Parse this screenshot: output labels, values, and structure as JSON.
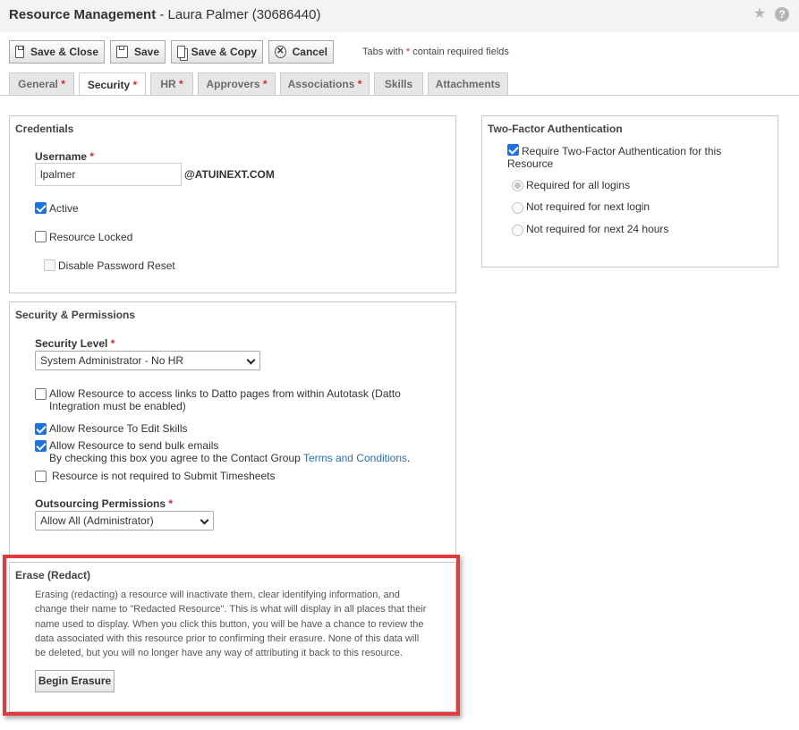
{
  "header": {
    "title_bold": "Resource Management",
    "title_rest": " - Laura Palmer (30686440)",
    "star_icon": "star-icon",
    "help_icon": "help-icon",
    "help_glyph": "?"
  },
  "toolbar": {
    "save_close_label": "Save & Close",
    "save_label": "Save",
    "save_copy_label": "Save & Copy",
    "cancel_label": "Cancel",
    "cancel_glyph": "✕",
    "required_note_prefix": "Tabs with ",
    "required_star": "*",
    "required_note_suffix": " contain required fields"
  },
  "tabs": [
    {
      "label": "General",
      "required": "*"
    },
    {
      "label": "Security",
      "required": "*"
    },
    {
      "label": "HR",
      "required": "*"
    },
    {
      "label": "Approvers",
      "required": "*"
    },
    {
      "label": "Associations",
      "required": "*"
    },
    {
      "label": "Skills",
      "required": ""
    },
    {
      "label": "Attachments",
      "required": ""
    }
  ],
  "credentials": {
    "heading": "Credentials",
    "username_label": "Username",
    "required_star": "*",
    "username_value": "lpalmer",
    "domain": "@ATUINEXT.COM",
    "active_label": "Active",
    "active_checked": true,
    "locked_label": "Resource Locked",
    "locked_checked": false,
    "disable_reset_label": "Disable Password Reset"
  },
  "security": {
    "heading": "Security & Permissions",
    "level_label": "Security Level",
    "required_star": "*",
    "level_value": "System Administrator - No HR",
    "datto_line1": "Allow Resource to access links to Datto pages from within Autotask (Datto",
    "datto_line2": "Integration must be enabled)",
    "edit_skills_label": "Allow Resource To Edit Skills",
    "bulk_email_label": "Allow Resource to send bulk emails",
    "terms_prefix": "By checking this box you agree to the Contact Group ",
    "terms_link": "Terms and Conditions",
    "terms_suffix": ".",
    "timesheets_label": "Resource is not required to Submit Timesheets",
    "outsourcing_label": "Outsourcing Permissions",
    "outsourcing_value": "Allow All (Administrator)"
  },
  "erase": {
    "heading": "Erase (Redact)",
    "line1": "Erasing (redacting) a resource will inactivate them, clear identifying information, and",
    "line2": "change their name to \"Redacted Resource\". This is what will display in all places that their",
    "line3": "name used to display. When you click this button, you will be have a chance to review the",
    "line4": "data associated with this resource prior to confirming their erasure. None of this data will",
    "line5": "be deleted, but you will no longer have any way of attributing it back to this resource.",
    "button_label": "Begin Erasure",
    "highlight_color": "#e03a3e"
  },
  "twofactor": {
    "heading": "Two-Factor Authentication",
    "require_line1": "Require Two-Factor Authentication for this",
    "require_line2": "Resource",
    "require_checked": true,
    "options": [
      "Required for all logins",
      "Not required for next login",
      "Not required for next 24 hours"
    ],
    "selected": "Required for all logins"
  },
  "colors": {
    "accent": "#1a73e8",
    "required": "#d9262d",
    "link": "#2a6ebb"
  }
}
